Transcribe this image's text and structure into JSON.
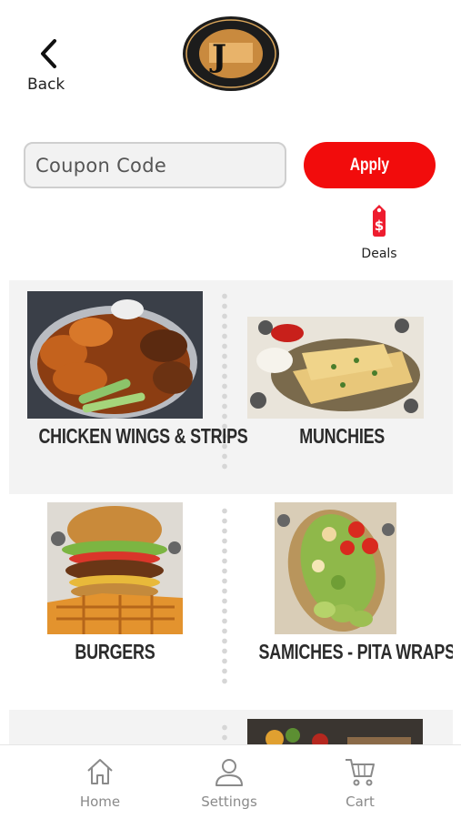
{
  "header": {
    "back_label": "Back",
    "logo": {
      "name": "JEXAL'S",
      "top_text": "FOOD • FAMILY • FUN",
      "bottom_text": "WING-ZERIA",
      "left_text": "ANTIOCH",
      "right_text": "BRENTWOOD"
    }
  },
  "coupon": {
    "placeholder": "Coupon Code",
    "apply_label": "Apply"
  },
  "deals": {
    "label": "Deals"
  },
  "categories": [
    {
      "label": "CHICKEN WINGS & STRIPS",
      "image": "chicken-wings-photo"
    },
    {
      "label": "MUNCHIES",
      "image": "munchies-photo"
    },
    {
      "label": "BURGERS",
      "image": "burgers-photo"
    },
    {
      "label": "SAMICHES - PITA WRAPS",
      "image": "samiches-photo"
    }
  ],
  "nav": {
    "items": [
      {
        "label": "Home",
        "icon": "home-icon"
      },
      {
        "label": "Settings",
        "icon": "person-icon"
      },
      {
        "label": "Cart",
        "icon": "cart-icon"
      }
    ]
  },
  "colors": {
    "accent": "#f20c0c",
    "grid_row_alt": "#f3f3f3",
    "nav_text": "#8a8a8a"
  }
}
